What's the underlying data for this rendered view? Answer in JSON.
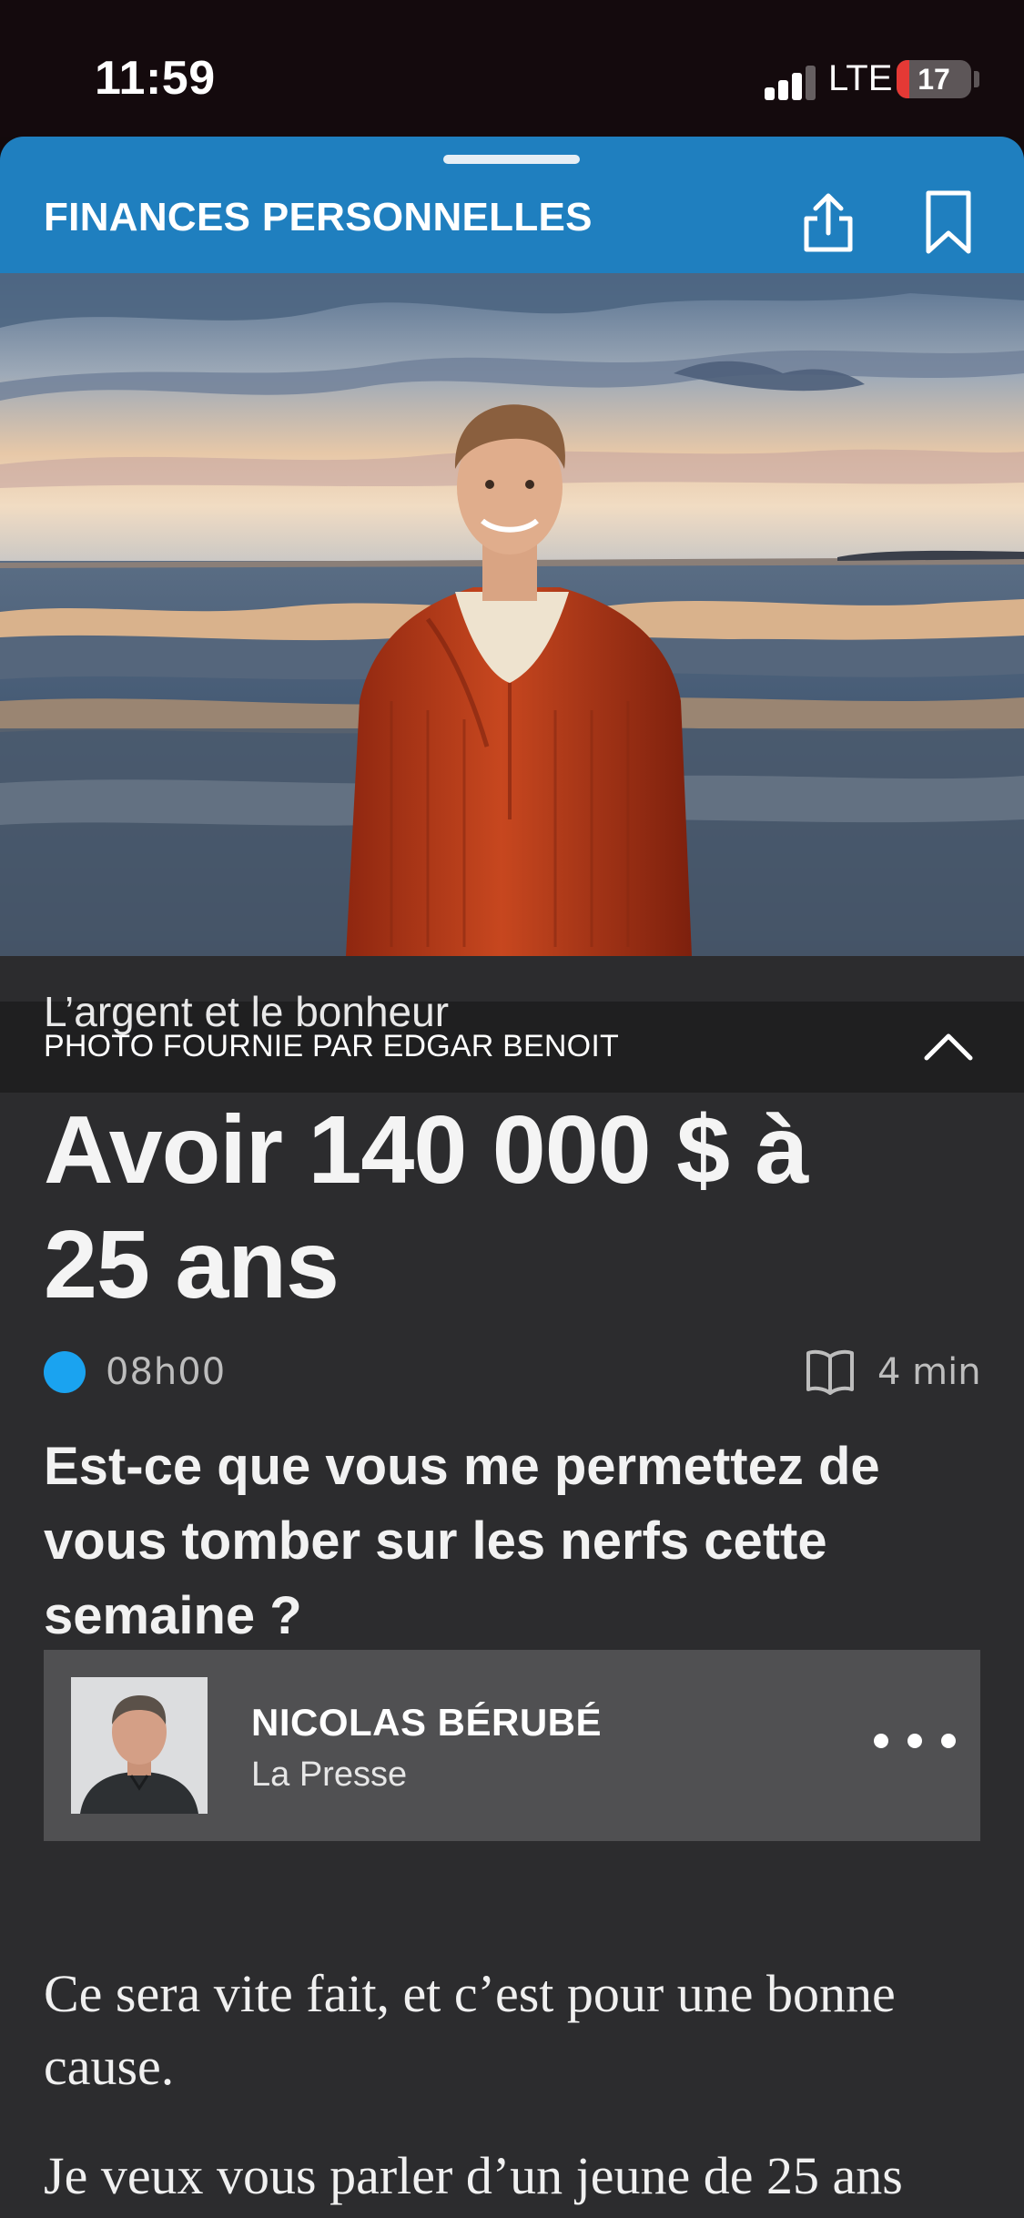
{
  "status_bar": {
    "time": "11:59",
    "network": "LTE",
    "battery_level": "17",
    "battery_fraction": 0.17,
    "signal_bars_active": 3,
    "signal_bars_total": 4
  },
  "header": {
    "section": "FINANCES PERSONNELLES",
    "share_icon": "share-icon",
    "bookmark_icon": "bookmark-icon",
    "color": "#1f7fbf"
  },
  "hero": {
    "caption": "PHOTO FOURNIE PAR EDGAR BENOIT",
    "toggle_icon": "chevron-up-icon"
  },
  "article": {
    "kicker": "L’argent et le bonheur",
    "headline_line1": "Avoir 140 000 $ à",
    "headline_line2": "25 ans",
    "time": "08h00",
    "live_dot_color": "#1aa3f0",
    "read_icon": "book-icon",
    "read_time": "4 min",
    "subhead": "Est-ce que vous me permettez de vous tomber sur les nerfs cette semaine ?"
  },
  "author": {
    "name": "NICOLAS BÉRUBÉ",
    "org": "La Presse",
    "more_icon": "more-icon"
  },
  "body": {
    "paragraph_1": "Ce sera vite fait, et c’est pour une bonne cause.",
    "paragraph_2": "Je veux vous parler d’un jeune de 25 ans"
  }
}
